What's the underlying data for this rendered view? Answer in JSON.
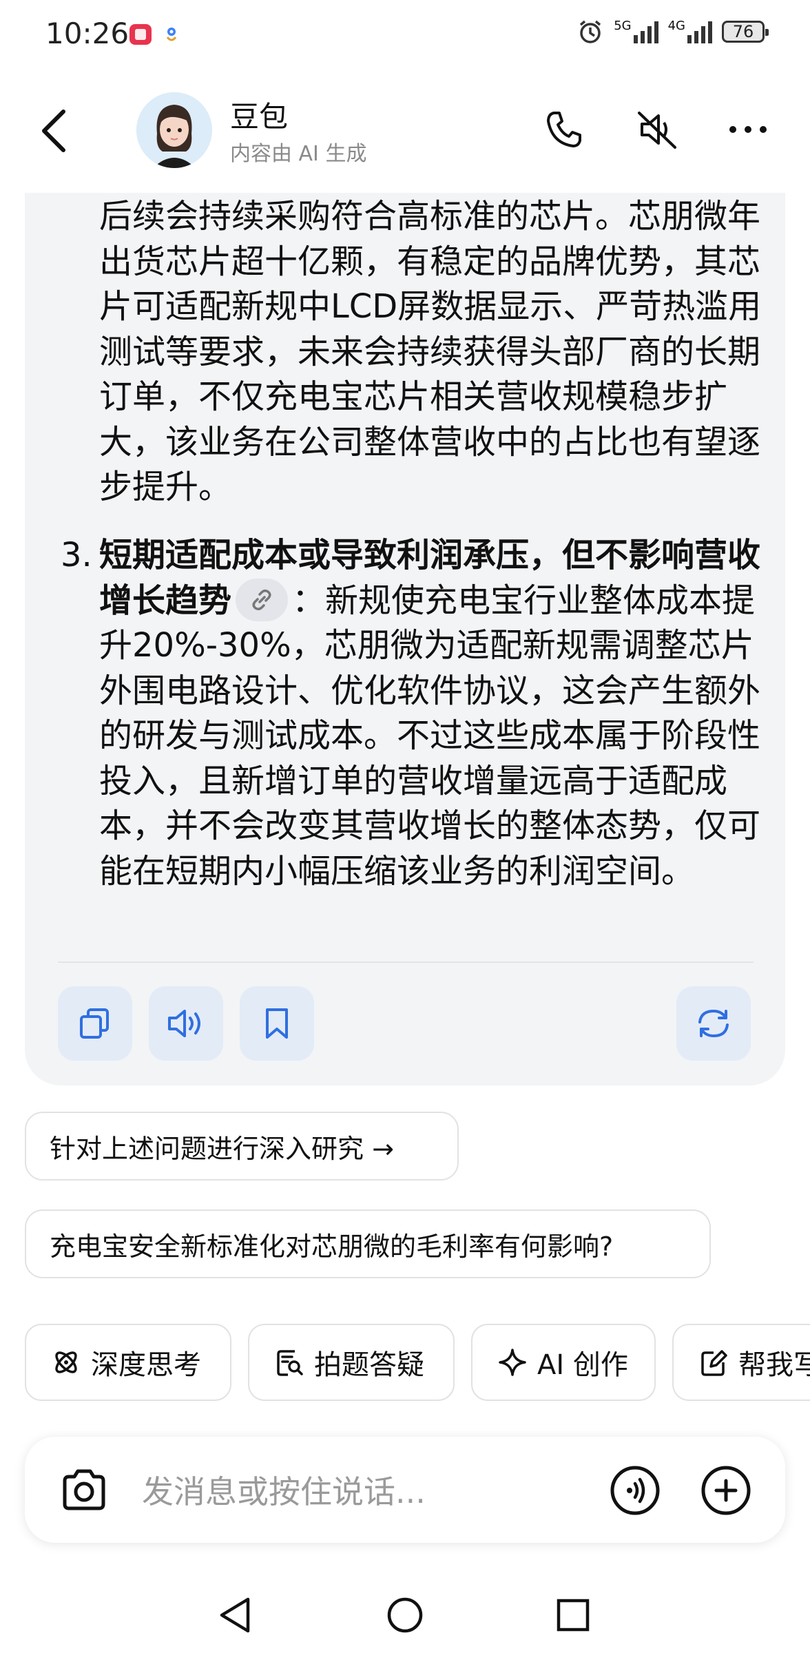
{
  "status_bar": {
    "time": "10:26",
    "net_1": "5G",
    "net_2": "4G",
    "battery": "76"
  },
  "header": {
    "title": "豆包",
    "subtitle": "内容由 AI 生成"
  },
  "message": {
    "para_a": "后续会持续采购符合高标准的芯片。芯朋微年出货芯片超十亿颗，有稳定的品牌优势，其芯片可适配新规中LCD屏数据显示、严苛热滥用测试等要求，未来会持续获得头部厂商的长期订单，不仅充电宝芯片相关营收规模稳步扩大，该业务在公司整体营收中的占比也有望逐步提升。",
    "item_number": "3.",
    "item_heading": "短期适配成本或导致利润承压，但不影响营收增长趋势",
    "item_colon": "：",
    "item_body": "新规使充电宝行业整体成本提升20%-30%，芯朋微为适配新规需调整芯片外围电路设计、优化软件协议，这会产生额外的研发与测试成本。不过这些成本属于阶段性投入，且新增订单的营收增量远高于适配成本，并不会改变其营收增长的整体态势，仅可能在短期内小幅压缩该业务的利润空间。"
  },
  "suggestions": [
    "针对上述问题进行深入研究 →",
    "充电宝安全新标准化对芯朋微的毛利率有何影响?"
  ],
  "features": [
    {
      "label": "深度思考",
      "icon": "atom-icon"
    },
    {
      "label": "拍题答疑",
      "icon": "photo-search-icon"
    },
    {
      "label": "AI 创作",
      "icon": "sparkle-icon"
    },
    {
      "label": "帮我写",
      "icon": "edit-icon"
    }
  ],
  "input": {
    "placeholder": "发消息或按住说话..."
  },
  "colors": {
    "accent": "#2f6fe0",
    "card_bg": "#f3f4f6",
    "tool_bg": "#e3ebf7"
  }
}
